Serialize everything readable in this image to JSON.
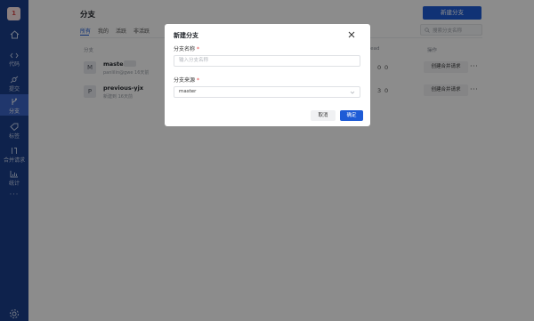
{
  "sidebar": {
    "avatar": "1",
    "items": [
      {
        "label": "代码",
        "icon": "code-icon"
      },
      {
        "label": "提交",
        "icon": "commit-icon"
      },
      {
        "label": "分支",
        "icon": "branch-icon",
        "active": true
      },
      {
        "label": "标签",
        "icon": "tag-icon"
      },
      {
        "label": "合并请求",
        "icon": "merge-request-icon"
      },
      {
        "label": "统计",
        "icon": "chart-icon"
      }
    ],
    "more": "···"
  },
  "main": {
    "title": "分支",
    "new_branch_button": "新建分支",
    "tabs": [
      "所有",
      "我的",
      "活跃",
      "非活跃"
    ],
    "search_placeholder": "搜索分支名称",
    "headers": {
      "branch": "分支",
      "behind_ahead": "Behind/Ahead",
      "actions": "操作"
    },
    "branches": [
      {
        "initial": "M",
        "name": "master",
        "meta": "panlilin@gwe 16天前",
        "behind": "0",
        "ahead": "0",
        "action": "创建合并请求"
      },
      {
        "initial": "P",
        "name": "previous-yjx",
        "meta": "新建到 16天前",
        "behind": "3",
        "ahead": "0",
        "action": "创建合并请求"
      }
    ]
  },
  "modal": {
    "title": "新建分支",
    "name_label": "分支名称",
    "name_placeholder": "输入分支名称",
    "source_label": "分支来源",
    "source_value": "master",
    "cancel": "取消",
    "confirm": "确定",
    "required_mark": "*"
  },
  "colors": {
    "primary": "#1e5bd6",
    "sidebar": "#1b3f8b",
    "sidebar_active": "#3b64c7"
  }
}
